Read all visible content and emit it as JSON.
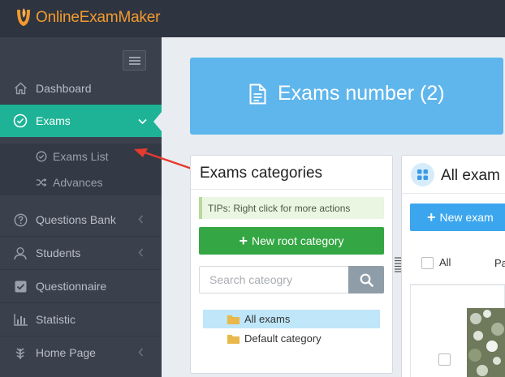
{
  "brand": {
    "name": "OnlineExamMaker",
    "color": "#f29a2e"
  },
  "sidebar": {
    "items": [
      {
        "label": "Dashboard",
        "icon": "home-icon"
      },
      {
        "label": "Exams",
        "icon": "check-circle-icon",
        "active": true
      },
      {
        "label": "Questions Bank",
        "icon": "question-circle-icon"
      },
      {
        "label": "Students",
        "icon": "users-icon"
      },
      {
        "label": "Questionnaire",
        "icon": "check-square-icon"
      },
      {
        "label": "Statistic",
        "icon": "bar-chart-icon"
      },
      {
        "label": "Home Page",
        "icon": "leaf-icon"
      }
    ],
    "sub_items": [
      {
        "label": "Exams List",
        "icon": "check-circle-icon"
      },
      {
        "label": "Advances",
        "icon": "shuffle-icon"
      }
    ],
    "active_color": "#1eb396"
  },
  "banner": {
    "label": "Exams number (2)",
    "icon": "document-icon",
    "color": "#5fb6ec"
  },
  "categories_panel": {
    "title": "Exams categories",
    "tips": "TIPs: Right click for more actions",
    "new_root_label": "New root category",
    "search_placeholder": "Search cateogry",
    "tree": [
      {
        "label": "All exams",
        "selected": true
      },
      {
        "label": "Default category",
        "selected": false
      }
    ]
  },
  "exams_panel": {
    "title": "All exam",
    "new_exam_label": "New exam",
    "select_all_label": "All",
    "column_partial": "Pa"
  },
  "colors": {
    "green_button": "#34a744",
    "blue_button": "#3ba6ee",
    "annotation_arrow": "#e53a2f"
  }
}
